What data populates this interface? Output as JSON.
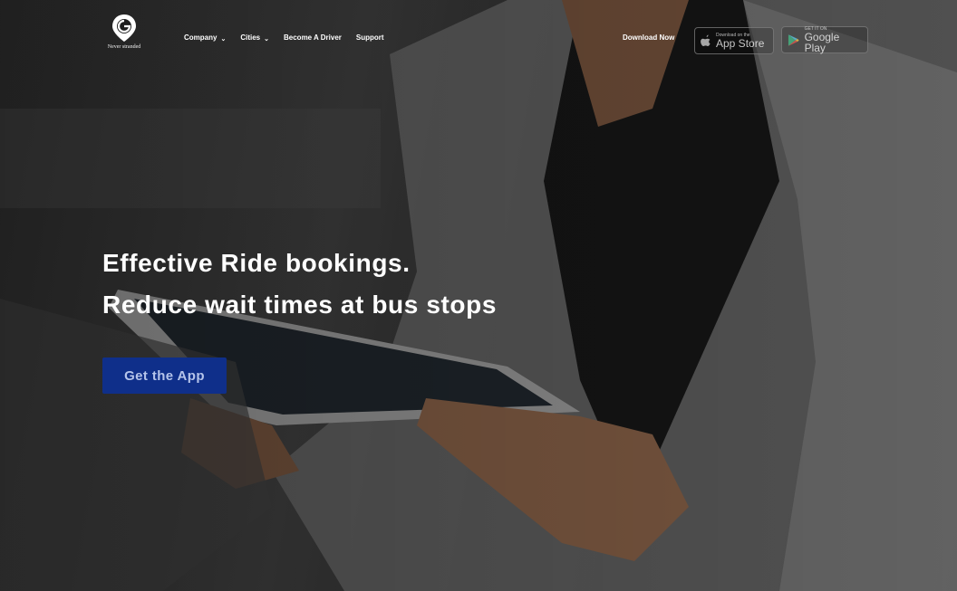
{
  "brand": {
    "tagline": "Never stranded",
    "logo_icon": "map-pin-logo-icon"
  },
  "nav": {
    "items": [
      {
        "label": "Company",
        "has_dropdown": true
      },
      {
        "label": "Cities",
        "has_dropdown": true
      },
      {
        "label": "Become A Driver",
        "has_dropdown": false
      },
      {
        "label": "Support",
        "has_dropdown": false
      }
    ],
    "dropdown_glyph": "⌄"
  },
  "download": {
    "label": "Download Now",
    "app_store": {
      "small": "Download on the",
      "big": "App Store",
      "icon": "apple-icon"
    },
    "google_play": {
      "small": "GET IT ON",
      "big": "Google Play",
      "icon": "play-icon"
    }
  },
  "hero": {
    "line1": "Effective Ride bookings.",
    "line2": "Reduce wait times at bus stops",
    "cta_label": "Get the App"
  },
  "colors": {
    "cta_bg": "#0f2f8a",
    "cta_text": "#b5c4ea",
    "background": "#2a2a2a"
  }
}
